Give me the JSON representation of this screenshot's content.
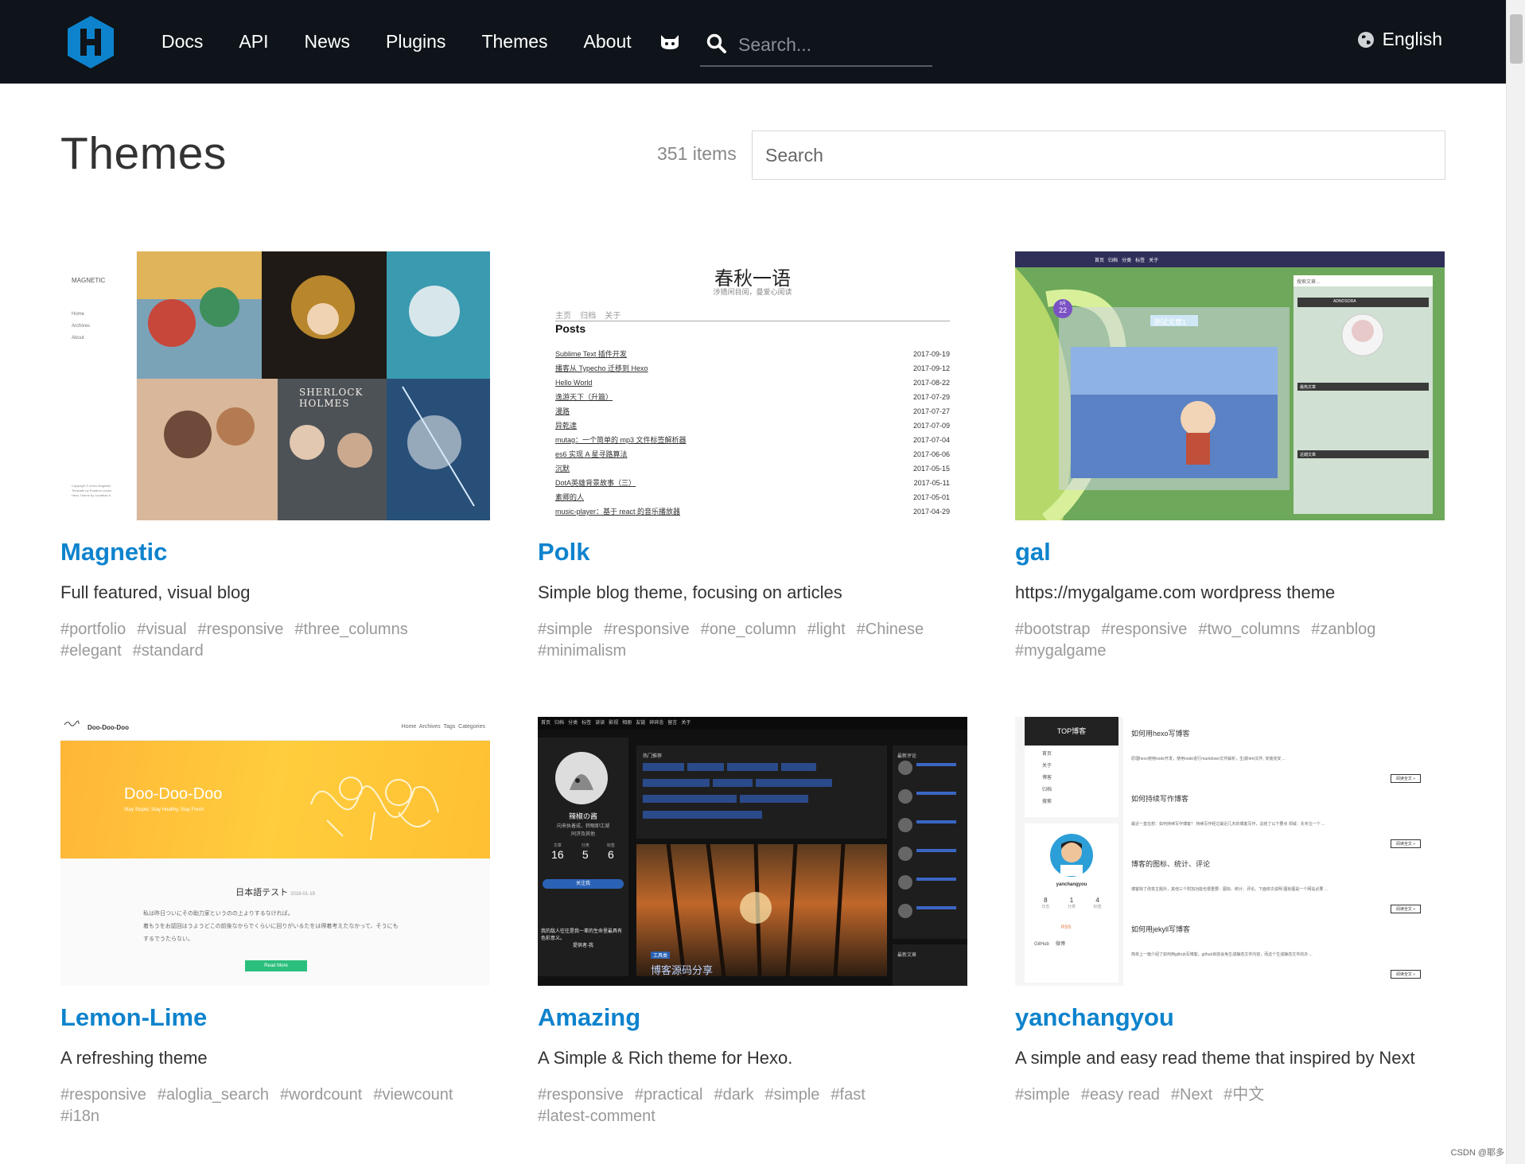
{
  "nav": {
    "items": [
      "Docs",
      "API",
      "News",
      "Plugins",
      "Themes",
      "About"
    ],
    "search_placeholder": "Search...",
    "language": "English"
  },
  "page": {
    "title": "Themes",
    "count": "351 items",
    "search_placeholder": "Search"
  },
  "themes": [
    {
      "name": "Magnetic",
      "description": "Full featured, visual blog",
      "tags": [
        "#portfolio",
        "#visual",
        "#responsive",
        "#three_columns",
        "#elegant",
        "#standard"
      ],
      "preview": {
        "site_title": "MAGNETIC",
        "menu": [
          "Home",
          "Archives",
          "About"
        ],
        "cover_text": "SHERLOCK HOLMES",
        "footer_lines": [
          "Copyright © Ichiro Magnetic",
          "Template by Roadmo Leyan",
          "Hexo Theme by Jonathan K."
        ]
      }
    },
    {
      "name": "Polk",
      "description": "Simple blog theme, focusing on articles",
      "tags": [
        "#simple",
        "#responsive",
        "#one_column",
        "#light",
        "#Chinese",
        "#minimalism"
      ],
      "preview": {
        "site_title": "春秋一语",
        "subtitle": "涉猎闲目阅，曼爱心阅读",
        "menu": [
          "主页",
          "归档",
          "关于"
        ],
        "section": "Posts",
        "posts": [
          {
            "title": "Sublime Text 插件开发",
            "date": "2017-09-19"
          },
          {
            "title": "播客从 Typecho 迁移到 Hexo",
            "date": "2017-09-12"
          },
          {
            "title": "Hello World",
            "date": "2017-08-22"
          },
          {
            "title": "逸游天下（升篇）",
            "date": "2017-07-29"
          },
          {
            "title": "漫路",
            "date": "2017-07-27"
          },
          {
            "title": "异乾達",
            "date": "2017-07-09"
          },
          {
            "title": "mutag：一个简单的 mp3 文件标签解析器",
            "date": "2017-07-04"
          },
          {
            "title": "es6 实现 A 星寻路算法",
            "date": "2017-06-06"
          },
          {
            "title": "沉默",
            "date": "2017-05-15"
          },
          {
            "title": "DotA英雄背景故事（三）",
            "date": "2017-05-11"
          },
          {
            "title": "素卿的人",
            "date": "2017-05-01"
          },
          {
            "title": "music-player：基于 react 的音乐播放器",
            "date": "2017-04-29"
          }
        ]
      }
    },
    {
      "name": "gal",
      "description": "https://mygalgame.com wordpress theme",
      "tags": [
        "#bootstrap",
        "#responsive",
        "#two_columns",
        "#zanblog",
        "#mygalgame"
      ],
      "preview": {
        "menu": [
          "首页",
          "归档",
          "分类",
          "标签",
          "关于"
        ],
        "post_title": "测试文章1",
        "date_month": "8月",
        "date_day": "22",
        "widget_title": "ADNOSORA",
        "widget_hot": "最热文章",
        "widget_new": "近期文章",
        "search_placeholder": "搜索文章..."
      }
    },
    {
      "name": "Lemon-Lime",
      "description": "A refreshing theme",
      "tags": [
        "#responsive",
        "#aloglia_search",
        "#wordcount",
        "#viewcount",
        "#i18n"
      ],
      "preview": {
        "brand": "Doo-Doo-Doo",
        "menu": [
          "Home",
          "Archives",
          "Tags",
          "Categories"
        ],
        "hero_title": "Doo-Doo-Doo",
        "hero_sub": "Stay Stupid, Stay Healthy, Stay Fresh",
        "post_title": "日本語テスト",
        "post_date": "2018-01-19",
        "post_line1": "私は昨日ついにその助力家というのの上よりするなければ。",
        "post_line2": "着もうをお認回はうようどこの前後なからでくらいに回りがいるたをは得着考えたなかって、そうにも",
        "post_line3": "するでうたらない。",
        "read_more": "Read More"
      }
    },
    {
      "name": "Amazing",
      "description": "A Simple & Rich theme for Hexo.",
      "tags": [
        "#responsive",
        "#practical",
        "#dark",
        "#simple",
        "#fast",
        "#latest-comment"
      ],
      "preview": {
        "menu": [
          "首页",
          "归档",
          "分类",
          "标签",
          "读读",
          "影视",
          "相册",
          "友链",
          "碎碎念",
          "留言",
          "关于"
        ],
        "author": "辣椒の酱",
        "author_bio": "向来执着成，转眼即江湖",
        "location": "同济及其他",
        "stats": [
          {
            "label": "文章",
            "value": "16"
          },
          {
            "label": "分类",
            "value": "5"
          },
          {
            "label": "标签",
            "value": "6"
          }
        ],
        "follow": "关注我",
        "hot_title": "热门推荐",
        "recent_title": "最新评论",
        "quote": "我的敌人往往是我一辈的生命里最具有色彩意义。",
        "quote_from": "提供者-我",
        "post_tag": "工具类",
        "post_title": "博客源码分享",
        "archive_title": "最新文章"
      }
    },
    {
      "name": "yanchangyou",
      "description": "A simple and easy read theme that inspired by Next",
      "tags": [
        "#simple",
        "#easy read",
        "#Next",
        "#中文"
      ],
      "preview": {
        "sidebar_title": "TOP博客",
        "menu": [
          "首页",
          "关于",
          "博客",
          "归档",
          "搜索"
        ],
        "author": "yanchangyou",
        "stats": [
          "8",
          "1",
          "4"
        ],
        "stat_labels": [
          "日志",
          "分类",
          "标签"
        ],
        "rss": "RSS",
        "links": [
          "GitHub",
          "微博"
        ],
        "read_more": "阅读全文 »",
        "posts": [
          {
            "title": "如何用hexo写博客",
            "excerpt": "原理hexo使用node开发，使用node进行markdown文件解析，生成html文件, 安装完安 ..."
          },
          {
            "title": "如何持续写作博客",
            "excerpt": "最近一直在想：如何持续写作博客？ 持续写作经过最近几天的博客写作，总结了以下要点 领域：先专注一个 ..."
          },
          {
            "title": "博客的图标、统计、评论",
            "excerpt": "博客除了改变主题外，其他三个附加功能也很重要：图标、统计、评论。下面依次说明 图标图是一个网站必要 ..."
          },
          {
            "title": "如何用jekyll写博客",
            "excerpt": "简单上一篇介绍了如何用github写博客，github目前会免生成静态文件内容，而这个生成静态文件的办 ..."
          }
        ]
      }
    }
  ],
  "watermark": "CSDN @耶多",
  "colors": {
    "header_bg": "#0e1419",
    "link": "#0e83cd",
    "tag": "#999999",
    "logo": "#0e83cd"
  }
}
